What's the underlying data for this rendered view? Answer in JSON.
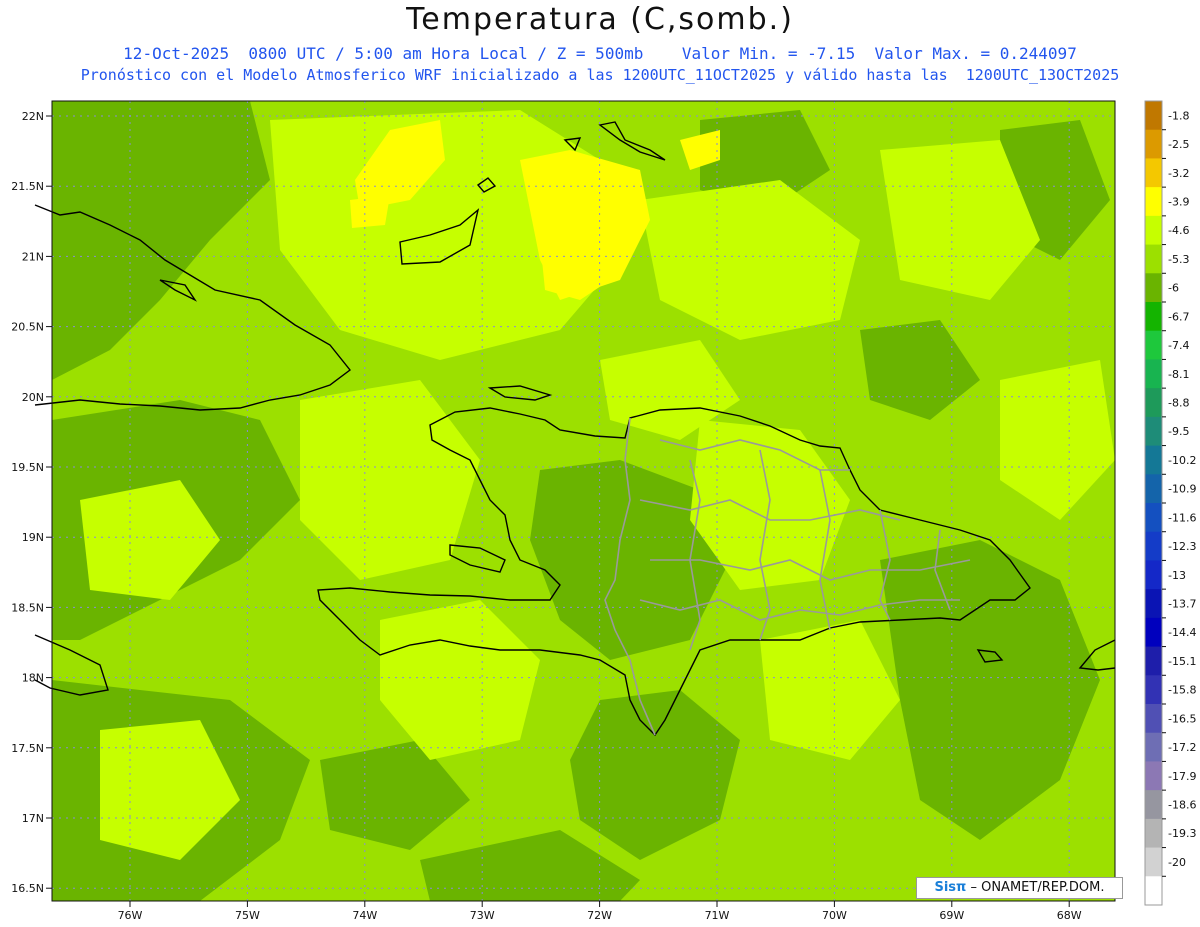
{
  "header": {
    "title": "Temperatura (C,somb.)",
    "line1": "12-Oct-2025  0800 UTC / 5:00 am Hora Local / Z = 500mb    Valor Min. = -7.15  Valor Max. = 0.244097",
    "line2": "Pronóstico con el Modelo Atmosferico WRF inicializado a las 1200UTC_11OCT2025 y válido hasta las  1200UTC_13OCT2025"
  },
  "axes": {
    "lat_labels": [
      "22N",
      "21.5N",
      "21N",
      "20.5N",
      "20N",
      "19.5N",
      "19N",
      "18.5N",
      "18N",
      "17.5N",
      "17N",
      "16.5N"
    ],
    "lon_labels": [
      "76W",
      "75W",
      "74W",
      "73W",
      "72W",
      "71W",
      "70W",
      "69W",
      "68W"
    ]
  },
  "colorbar": {
    "labels": [
      "-1.8",
      "-2.5",
      "-3.2",
      "-3.9",
      "-4.6",
      "-5.3",
      "-6",
      "-6.7",
      "-7.4",
      "-8.1",
      "-8.8",
      "-9.5",
      "-10.2",
      "-10.9",
      "-11.6",
      "-12.3",
      "-13",
      "-13.7",
      "-14.4",
      "-15.1",
      "-15.8",
      "-16.5",
      "-17.2",
      "-17.9",
      "-18.6",
      "-19.3",
      "-20"
    ],
    "colors": [
      "#c07800",
      "#dc9a00",
      "#f4c800",
      "#ffff00",
      "#c6ff00",
      "#9ce000",
      "#6ab400",
      "#14b400",
      "#1ec83c",
      "#18b450",
      "#1e9a5a",
      "#1e8c78",
      "#147896",
      "#1464aa",
      "#1450c0",
      "#143cc8",
      "#1428c8",
      "#0a14b4",
      "#0000be",
      "#1e1eaa",
      "#3232b4",
      "#5050b4",
      "#6e6eb4",
      "#8c78b4",
      "#9696a0",
      "#b4b4b4",
      "#d2d2d2",
      "#ffffff"
    ]
  },
  "field_colors": {
    "base": "#9ce000",
    "warm": "#c6ff00",
    "cold": "#6ab400",
    "warmer": "#ffff00"
  },
  "credit": {
    "brand": "Sisπ",
    "org": "– ONAMET/REP.DOM."
  }
}
